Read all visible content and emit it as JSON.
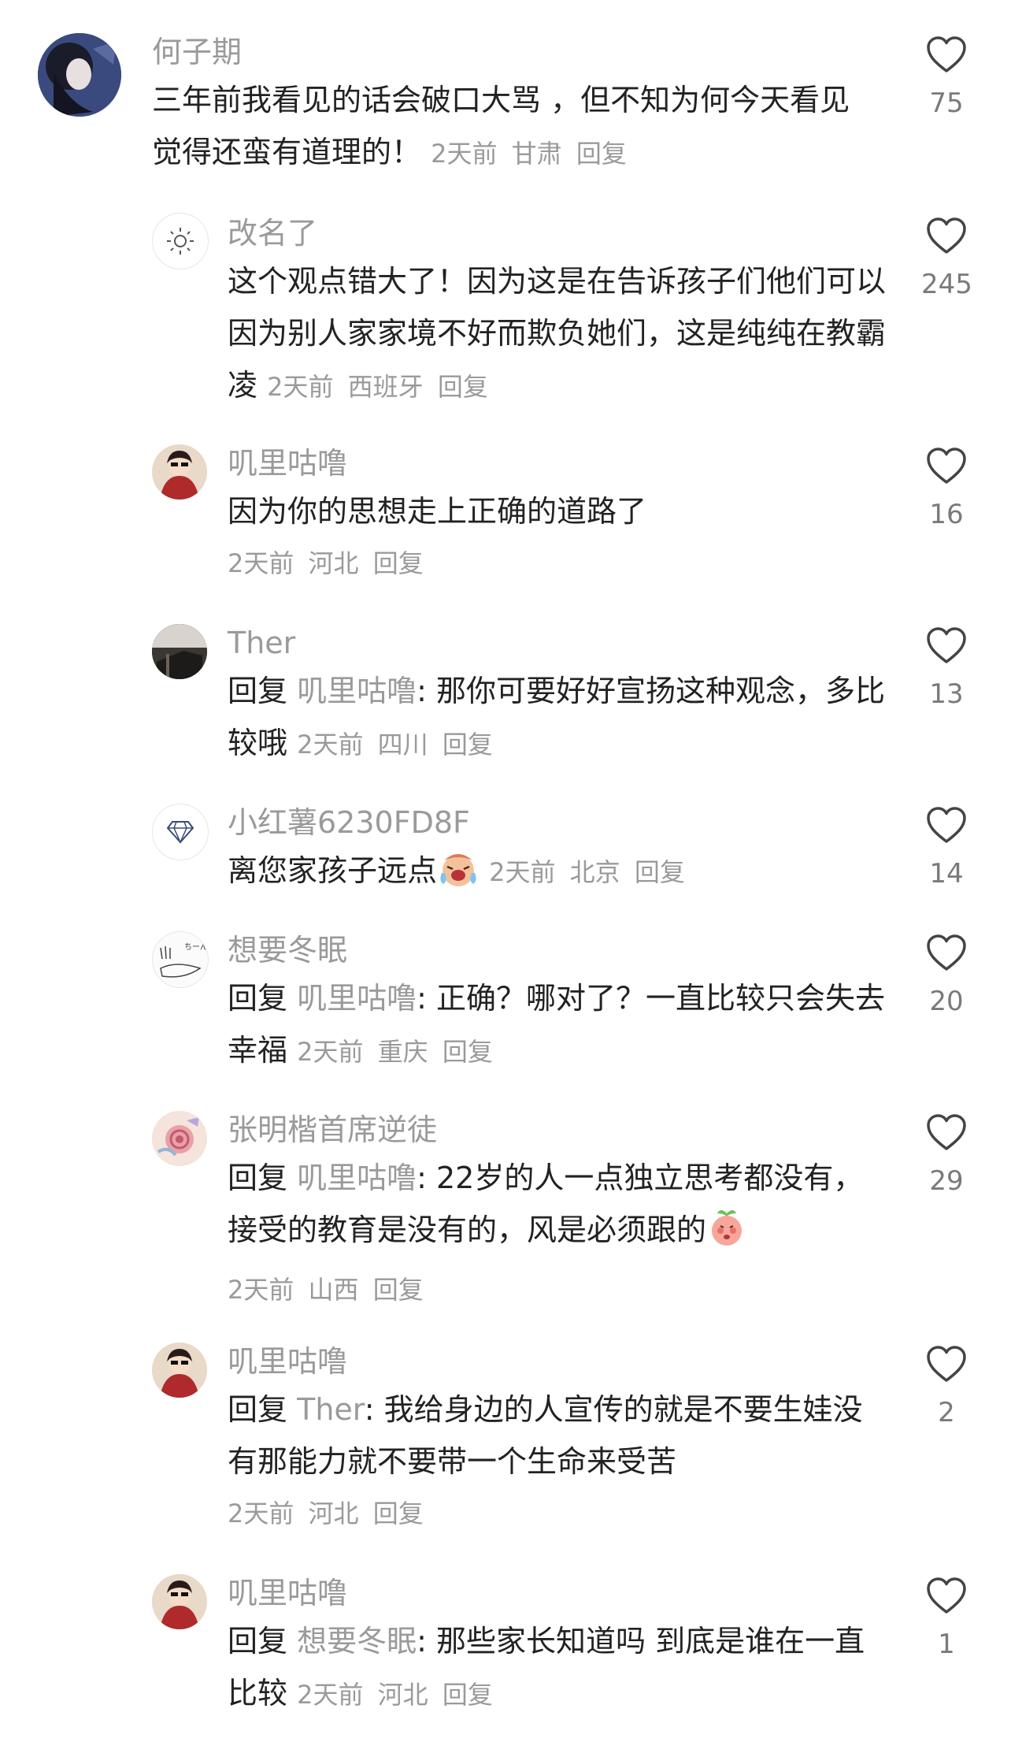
{
  "comments": [
    {
      "name": "何子期",
      "text": "三年前我看见的话会破口大骂 ，但不知为何今天看见觉得还蛮有道理的！",
      "time": "2天前",
      "location": "甘肃",
      "reply_label": "回复",
      "likes": "75",
      "avatar": "anime-girl-avatar"
    },
    {
      "name": "改名了",
      "text": "这个观点错大了！因为这是在告诉孩子们他们可以因为别人家家境不好而欺负她们，这是纯纯在教霸凌",
      "time": "2天前",
      "location": "西班牙",
      "reply_label": "回复",
      "likes": "245",
      "avatar": "sun-avatar"
    },
    {
      "name": "叽里咕噜",
      "text": "因为你的思想走上正确的道路了",
      "time": "2天前",
      "location": "河北",
      "reply_label": "回复",
      "likes": "16",
      "avatar": "sunglasses-girl-avatar"
    },
    {
      "name": "Ther",
      "prefix": "回复",
      "target": "叽里咕噜",
      "text": ": 那你可要好好宣扬这种观念，多比较哦",
      "time": "2天前",
      "location": "四川",
      "reply_label": "回复",
      "likes": "13",
      "avatar": "dark-photo-avatar"
    },
    {
      "name": "小红薯6230FD8F",
      "text": "离您家孩子远点",
      "emoji": "crying-face-emoji",
      "time": "2天前",
      "location": "北京",
      "reply_label": "回复",
      "likes": "14",
      "avatar": "diamond-avatar"
    },
    {
      "name": "想要冬眠",
      "prefix": "回复",
      "target": "叽里咕噜",
      "text": ": 正确？哪对了？一直比较只会失去幸福",
      "time": "2天前",
      "location": "重庆",
      "reply_label": "回复",
      "likes": "20",
      "avatar": "sketch-avatar"
    },
    {
      "name": "张明楷首席逆徒",
      "prefix": "回复",
      "target": "叽里咕噜",
      "text": ": 22岁的人一点独立思考都没有，接受的教育是没有的，风是必须跟的",
      "emoji": "peach-face-emoji",
      "time": "2天前",
      "location": "山西",
      "reply_label": "回复",
      "likes": "29",
      "avatar": "flower-avatar"
    },
    {
      "name": "叽里咕噜",
      "prefix": "回复",
      "target": "Ther",
      "text": ": 我给身边的人宣传的就是不要生娃没有那能力就不要带一个生命来受苦",
      "time": "2天前",
      "location": "河北",
      "reply_label": "回复",
      "likes": "2",
      "avatar": "sunglasses-girl-avatar"
    },
    {
      "name": "叽里咕噜",
      "prefix": "回复",
      "target": "想要冬眠",
      "text": ": 那些家长知道吗  到底是谁在一直比较",
      "time": "2天前",
      "location": "河北",
      "reply_label": "回复",
      "likes": "1",
      "avatar": "sunglasses-girl-avatar"
    }
  ],
  "colors": {
    "secondary": "#9a9a9a",
    "primary": "#222222",
    "heart": "#444444"
  }
}
